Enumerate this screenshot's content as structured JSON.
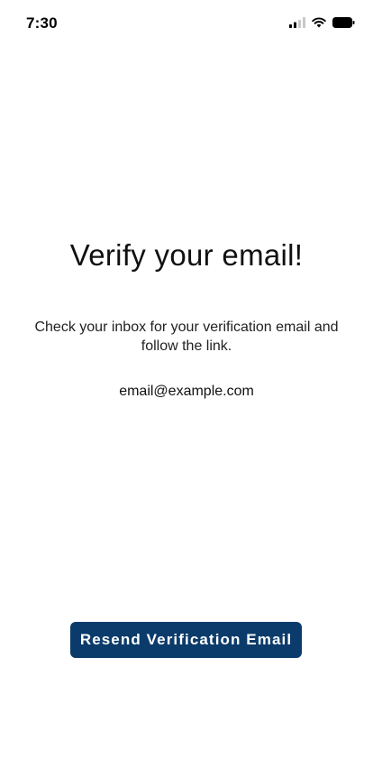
{
  "status_bar": {
    "time": "7:30",
    "icons": [
      "signal-icon",
      "wifi-icon",
      "battery-icon"
    ]
  },
  "main": {
    "title": "Verify your email!",
    "message": "Check your inbox for your verification email and follow the link.",
    "email": "email@example.com"
  },
  "actions": {
    "resend_label": "Resend Verification Email"
  },
  "colors": {
    "button_background": "#0b3b6a",
    "button_text": "#ffffff",
    "background": "#ffffff",
    "text": "#111111"
  }
}
